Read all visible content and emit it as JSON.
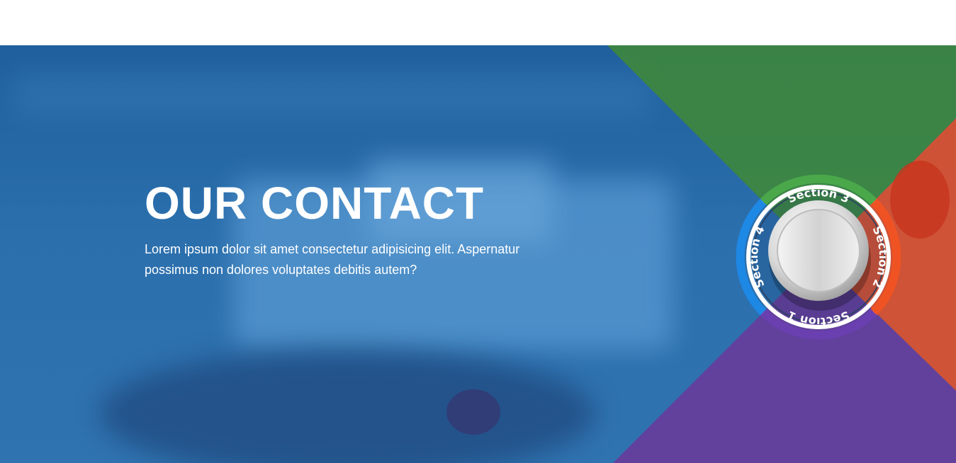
{
  "hero": {
    "title": "OUR CONTACT",
    "text": "Lorem ipsum dolor sit amet consectetur adipisicing elit. Aspernatur possimus non dolores voluptates debitis autem?"
  },
  "dial": {
    "sections": [
      {
        "label": "Section 1",
        "color": "#6a3fb0"
      },
      {
        "label": "Section 2",
        "color": "#f05323"
      },
      {
        "label": "Section 3",
        "color": "#4aa84a"
      },
      {
        "label": "Section 4",
        "color": "#1e88e5"
      }
    ]
  },
  "colors": {
    "hero_blue": "#2b6fad",
    "quadrant_green": "#3f8a36",
    "quadrant_orange": "#e0502a",
    "quadrant_purple": "#6a3a9a"
  }
}
